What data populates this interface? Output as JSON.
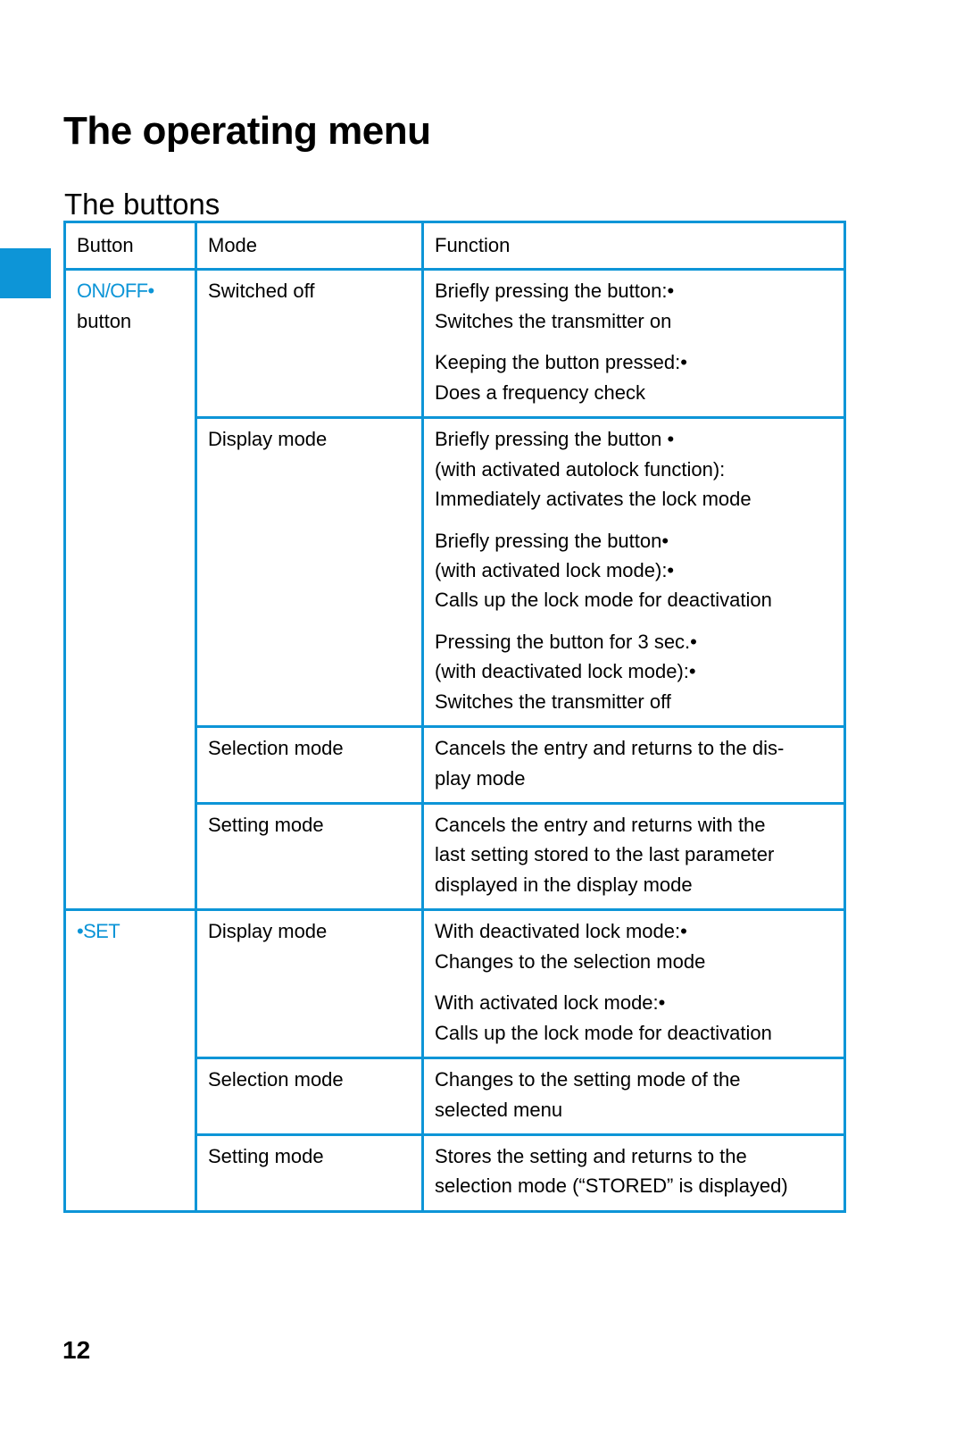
{
  "document": {
    "title": "The operating menu",
    "section_title": "The buttons",
    "page_number": "12",
    "accent_color": "#0d95d7"
  },
  "table": {
    "headers": {
      "button": "Button",
      "mode": "Mode",
      "function": "Function"
    },
    "buttons": [
      {
        "label": "ON/OFF",
        "label_bullet": "•",
        "sub_label": "button",
        "rows": [
          {
            "mode": "Switched off",
            "groups": [
              [
                "Briefly pressing the button:•",
                "Switches the transmitter on"
              ],
              [
                "Keeping the button pressed:•",
                "Does a frequency check"
              ]
            ]
          },
          {
            "mode": "Display mode",
            "groups": [
              [
                "Briefly pressing the button •",
                "(with activated autolock function):",
                "Immediately activates the lock mode"
              ],
              [
                "Briefly pressing the button•",
                "(with activated lock mode):•",
                "Calls up the lock mode for deactivation"
              ],
              [
                "Pressing the button for 3 sec.•",
                "(with deactivated lock mode):•",
                "Switches the transmitter off"
              ]
            ]
          },
          {
            "mode": "Selection mode",
            "groups": [
              [
                "Cancels the entry and returns to the dis-",
                "play mode"
              ]
            ]
          },
          {
            "mode": "Setting mode",
            "groups": [
              [
                "Cancels the entry and returns with the",
                "last setting stored to the last parameter",
                "displayed in the display mode"
              ]
            ]
          }
        ]
      },
      {
        "label": "SET",
        "label_bullet": "•",
        "sub_label": "",
        "rows": [
          {
            "mode": "Display mode",
            "groups": [
              [
                "With deactivated lock mode:•",
                "Changes to the selection mode"
              ],
              [
                "With activated lock mode:•",
                "Calls up the lock mode for deactivation"
              ]
            ]
          },
          {
            "mode": "Selection mode",
            "groups": [
              [
                "Changes to the setting mode of the",
                "selected menu"
              ]
            ]
          },
          {
            "mode": "Setting mode",
            "groups": [
              [
                "Stores the setting and returns to the",
                "selection mode (“STORED” is displayed)"
              ]
            ]
          }
        ]
      }
    ]
  }
}
